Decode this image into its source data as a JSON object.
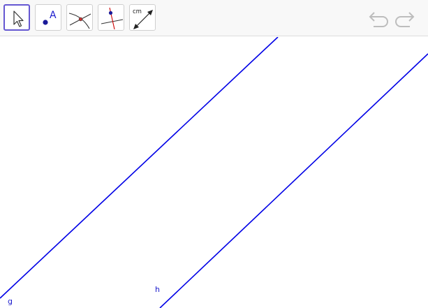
{
  "toolbar": {
    "tools": [
      {
        "icon": "move-arrow-icon",
        "selected": true
      },
      {
        "icon": "point-tool-icon",
        "label": "A"
      },
      {
        "icon": "intersect-tool-icon"
      },
      {
        "icon": "perpendicular-line-tool-icon"
      },
      {
        "icon": "distance-measure-tool-icon",
        "label": "cm"
      }
    ],
    "undo_icon": "undo-icon",
    "redo_icon": "redo-icon"
  },
  "canvas": {
    "line_color": "#0000e6",
    "lines": [
      {
        "name": "g"
      },
      {
        "name": "h"
      }
    ]
  },
  "colors": {
    "accent": "#6557d2",
    "point": "#1a1a99",
    "perpendicular": "#cc0000"
  }
}
